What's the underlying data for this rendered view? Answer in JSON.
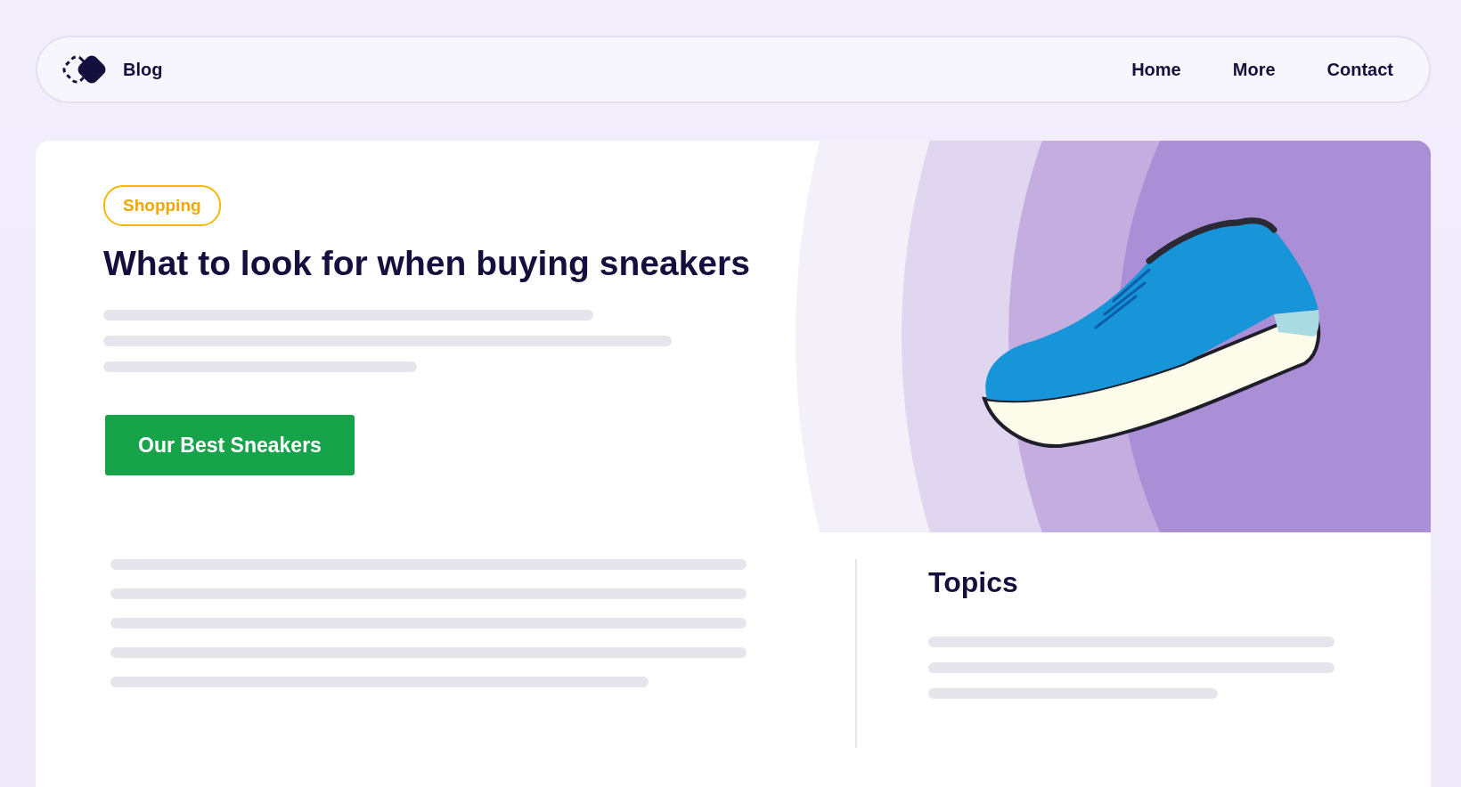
{
  "nav": {
    "brand": "Blog",
    "links": [
      "Home",
      "More",
      "Contact"
    ]
  },
  "hero": {
    "tag": "Shopping",
    "headline": "What to look for when buying sneakers",
    "cta": "Our Best Sneakers"
  },
  "sidebar": {
    "heading": "Topics"
  }
}
